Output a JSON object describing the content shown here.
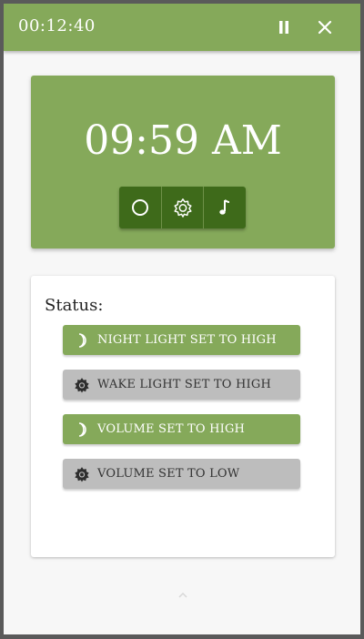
{
  "header": {
    "timer": "00:12:40",
    "pause_icon": "pause-icon",
    "close_icon": "close-icon"
  },
  "clock": {
    "time": "09:59 AM",
    "modes": [
      {
        "icon": "circle-icon"
      },
      {
        "icon": "sun-gear-icon"
      },
      {
        "icon": "music-note-icon"
      }
    ]
  },
  "status": {
    "heading": "Status:",
    "items": [
      {
        "label": "NIGHT LIGHT SET TO HIGH",
        "icon": "moon-icon",
        "color": "#85a95a"
      },
      {
        "label": "WAKE LIGHT SET TO HIGH",
        "icon": "sun-icon",
        "color": "#bdbdbd"
      },
      {
        "label": "VOLUME SET TO HIGH",
        "icon": "moon-icon",
        "color": "#85a95a"
      },
      {
        "label": "VOLUME SET TO LOW",
        "icon": "sun-icon",
        "color": "#bdbdbd"
      }
    ]
  },
  "footer": {
    "expand_icon": "chevron-up-icon"
  },
  "colors": {
    "accent": "#85a95a",
    "accent_dark": "#3e6a1a",
    "inactive": "#bdbdbd"
  }
}
